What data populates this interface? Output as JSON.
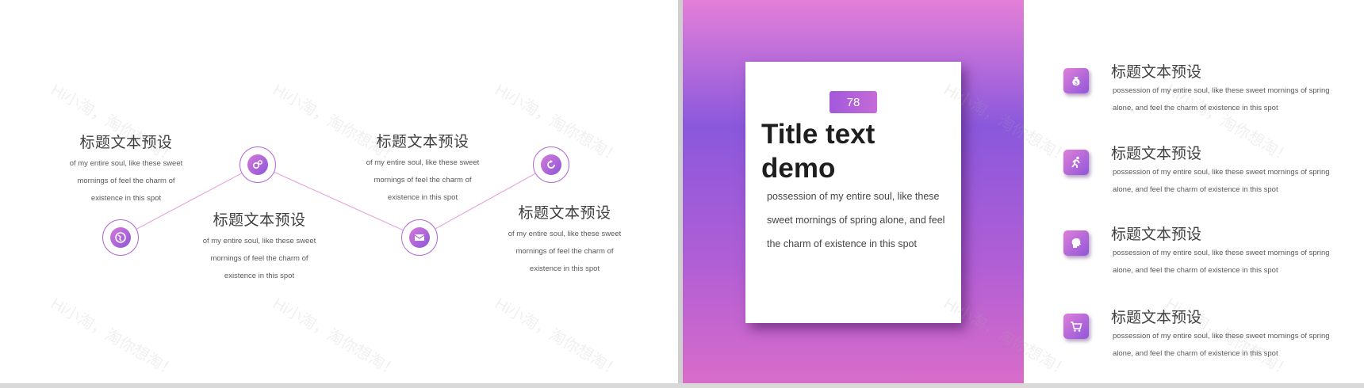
{
  "left_slide": {
    "steps": [
      {
        "title": "标题文本预设",
        "text": "of my entire soul, like these sweet mornings of feel the charm of existence in this spot",
        "icon": "globe-icon"
      },
      {
        "title": "标题文本预设",
        "text": "of my entire soul, like these sweet mornings of feel the charm of existence in this spot",
        "icon": "gears-icon"
      },
      {
        "title": "标题文本预设",
        "text": "of my entire soul, like these sweet mornings of feel the charm of existence in this spot",
        "icon": "envelope-icon"
      },
      {
        "title": "标题文本预设",
        "text": "of my entire soul, like these sweet mornings of feel the charm of existence in this spot",
        "icon": "refresh-icon"
      }
    ]
  },
  "right_slide": {
    "badge_number": "78",
    "title": "Title text demo",
    "body": "possession of my entire soul, like these sweet mornings of spring alone, and feel the charm of existence in this spot",
    "items": [
      {
        "title": "标题文本预设",
        "text": "possession of my entire soul, like these sweet mornings of spring alone, and feel the charm of existence in this spot",
        "icon": "money-bag-icon"
      },
      {
        "title": "标题文本预设",
        "text": "possession of my entire soul, like these sweet mornings of spring alone, and feel the charm of existence in this spot",
        "icon": "runner-icon"
      },
      {
        "title": "标题文本预设",
        "text": "possession of my entire soul, like these sweet mornings of spring alone, and feel the charm of existence in this spot",
        "icon": "head-icon"
      },
      {
        "title": "标题文本预设",
        "text": "possession of my entire soul, like these sweet mornings of spring alone, and feel the charm of existence in this spot",
        "icon": "cart-icon"
      }
    ]
  },
  "watermark": "Hi小淘，淘你想淘！",
  "colors": {
    "accent_pink": "#e47fd8",
    "accent_purple": "#8a58dc",
    "line": "#e2a6d9"
  }
}
